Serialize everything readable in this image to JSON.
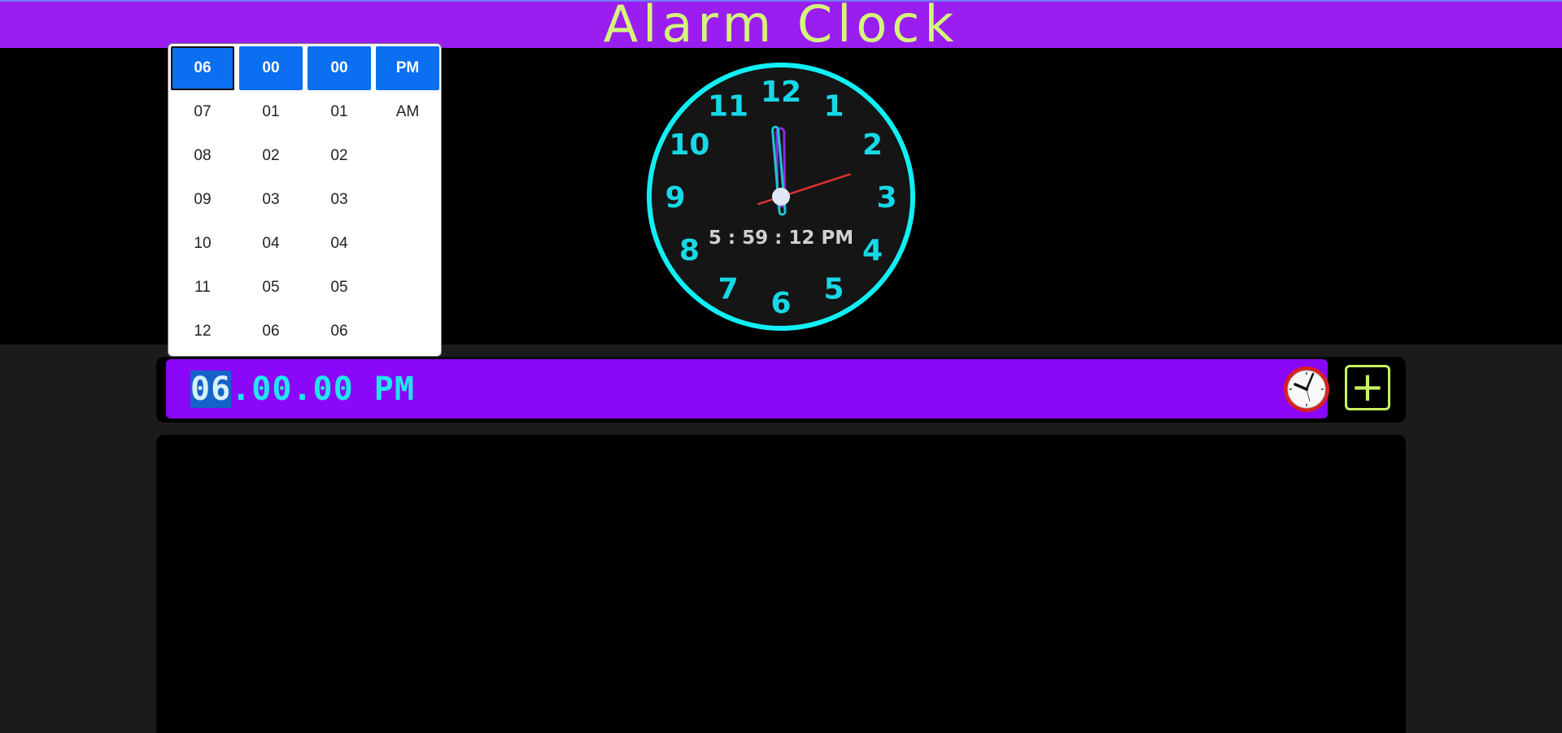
{
  "app": {
    "title": "Alarm Clock"
  },
  "clock": {
    "numerals": [
      "12",
      "1",
      "2",
      "3",
      "4",
      "5",
      "6",
      "7",
      "8",
      "9",
      "10",
      "11"
    ],
    "digital_time": "5 : 59 : 12 PM",
    "hands": {
      "hour": 5,
      "minute": 59,
      "second": 12
    },
    "colors": {
      "ring": "#0ff0f5",
      "numerals": "#17d8e6",
      "face": "#151515",
      "hour_hand": "#8a2be2",
      "minute_hand": "#20c6d6",
      "second_hand": "#e03030"
    }
  },
  "time_picker": {
    "hours": [
      "06",
      "07",
      "08",
      "09",
      "10",
      "11",
      "12"
    ],
    "minutes": [
      "00",
      "01",
      "02",
      "03",
      "04",
      "05",
      "06"
    ],
    "seconds": [
      "00",
      "01",
      "02",
      "03",
      "04",
      "05",
      "06"
    ],
    "meridiem": [
      "PM",
      "AM"
    ],
    "selected": {
      "hour": "06",
      "minute": "00",
      "second": "00",
      "meridiem": "PM"
    }
  },
  "alarm_input": {
    "hour": "06",
    "minute": "00",
    "second": "00",
    "meridiem": "PM",
    "separator": "."
  },
  "add_button": {
    "label": "+"
  },
  "colors": {
    "header_bg": "#9a1ef0",
    "title": "#d4f57a",
    "accent_blue": "#0a6ff0",
    "input_bg": "#8b07f7"
  }
}
